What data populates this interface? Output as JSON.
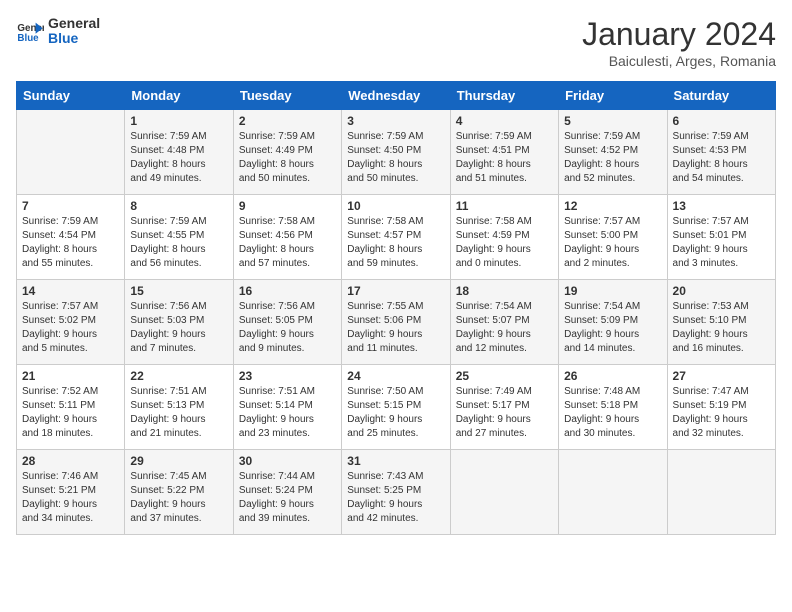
{
  "header": {
    "logo_general": "General",
    "logo_blue": "Blue",
    "month_title": "January 2024",
    "subtitle": "Baiculesti, Arges, Romania"
  },
  "days_of_week": [
    "Sunday",
    "Monday",
    "Tuesday",
    "Wednesday",
    "Thursday",
    "Friday",
    "Saturday"
  ],
  "weeks": [
    [
      {
        "day": "",
        "info": ""
      },
      {
        "day": "1",
        "info": "Sunrise: 7:59 AM\nSunset: 4:48 PM\nDaylight: 8 hours\nand 49 minutes."
      },
      {
        "day": "2",
        "info": "Sunrise: 7:59 AM\nSunset: 4:49 PM\nDaylight: 8 hours\nand 50 minutes."
      },
      {
        "day": "3",
        "info": "Sunrise: 7:59 AM\nSunset: 4:50 PM\nDaylight: 8 hours\nand 50 minutes."
      },
      {
        "day": "4",
        "info": "Sunrise: 7:59 AM\nSunset: 4:51 PM\nDaylight: 8 hours\nand 51 minutes."
      },
      {
        "day": "5",
        "info": "Sunrise: 7:59 AM\nSunset: 4:52 PM\nDaylight: 8 hours\nand 52 minutes."
      },
      {
        "day": "6",
        "info": "Sunrise: 7:59 AM\nSunset: 4:53 PM\nDaylight: 8 hours\nand 54 minutes."
      }
    ],
    [
      {
        "day": "7",
        "info": "Sunrise: 7:59 AM\nSunset: 4:54 PM\nDaylight: 8 hours\nand 55 minutes."
      },
      {
        "day": "8",
        "info": "Sunrise: 7:59 AM\nSunset: 4:55 PM\nDaylight: 8 hours\nand 56 minutes."
      },
      {
        "day": "9",
        "info": "Sunrise: 7:58 AM\nSunset: 4:56 PM\nDaylight: 8 hours\nand 57 minutes."
      },
      {
        "day": "10",
        "info": "Sunrise: 7:58 AM\nSunset: 4:57 PM\nDaylight: 8 hours\nand 59 minutes."
      },
      {
        "day": "11",
        "info": "Sunrise: 7:58 AM\nSunset: 4:59 PM\nDaylight: 9 hours\nand 0 minutes."
      },
      {
        "day": "12",
        "info": "Sunrise: 7:57 AM\nSunset: 5:00 PM\nDaylight: 9 hours\nand 2 minutes."
      },
      {
        "day": "13",
        "info": "Sunrise: 7:57 AM\nSunset: 5:01 PM\nDaylight: 9 hours\nand 3 minutes."
      }
    ],
    [
      {
        "day": "14",
        "info": "Sunrise: 7:57 AM\nSunset: 5:02 PM\nDaylight: 9 hours\nand 5 minutes."
      },
      {
        "day": "15",
        "info": "Sunrise: 7:56 AM\nSunset: 5:03 PM\nDaylight: 9 hours\nand 7 minutes."
      },
      {
        "day": "16",
        "info": "Sunrise: 7:56 AM\nSunset: 5:05 PM\nDaylight: 9 hours\nand 9 minutes."
      },
      {
        "day": "17",
        "info": "Sunrise: 7:55 AM\nSunset: 5:06 PM\nDaylight: 9 hours\nand 11 minutes."
      },
      {
        "day": "18",
        "info": "Sunrise: 7:54 AM\nSunset: 5:07 PM\nDaylight: 9 hours\nand 12 minutes."
      },
      {
        "day": "19",
        "info": "Sunrise: 7:54 AM\nSunset: 5:09 PM\nDaylight: 9 hours\nand 14 minutes."
      },
      {
        "day": "20",
        "info": "Sunrise: 7:53 AM\nSunset: 5:10 PM\nDaylight: 9 hours\nand 16 minutes."
      }
    ],
    [
      {
        "day": "21",
        "info": "Sunrise: 7:52 AM\nSunset: 5:11 PM\nDaylight: 9 hours\nand 18 minutes."
      },
      {
        "day": "22",
        "info": "Sunrise: 7:51 AM\nSunset: 5:13 PM\nDaylight: 9 hours\nand 21 minutes."
      },
      {
        "day": "23",
        "info": "Sunrise: 7:51 AM\nSunset: 5:14 PM\nDaylight: 9 hours\nand 23 minutes."
      },
      {
        "day": "24",
        "info": "Sunrise: 7:50 AM\nSunset: 5:15 PM\nDaylight: 9 hours\nand 25 minutes."
      },
      {
        "day": "25",
        "info": "Sunrise: 7:49 AM\nSunset: 5:17 PM\nDaylight: 9 hours\nand 27 minutes."
      },
      {
        "day": "26",
        "info": "Sunrise: 7:48 AM\nSunset: 5:18 PM\nDaylight: 9 hours\nand 30 minutes."
      },
      {
        "day": "27",
        "info": "Sunrise: 7:47 AM\nSunset: 5:19 PM\nDaylight: 9 hours\nand 32 minutes."
      }
    ],
    [
      {
        "day": "28",
        "info": "Sunrise: 7:46 AM\nSunset: 5:21 PM\nDaylight: 9 hours\nand 34 minutes."
      },
      {
        "day": "29",
        "info": "Sunrise: 7:45 AM\nSunset: 5:22 PM\nDaylight: 9 hours\nand 37 minutes."
      },
      {
        "day": "30",
        "info": "Sunrise: 7:44 AM\nSunset: 5:24 PM\nDaylight: 9 hours\nand 39 minutes."
      },
      {
        "day": "31",
        "info": "Sunrise: 7:43 AM\nSunset: 5:25 PM\nDaylight: 9 hours\nand 42 minutes."
      },
      {
        "day": "",
        "info": ""
      },
      {
        "day": "",
        "info": ""
      },
      {
        "day": "",
        "info": ""
      }
    ]
  ]
}
